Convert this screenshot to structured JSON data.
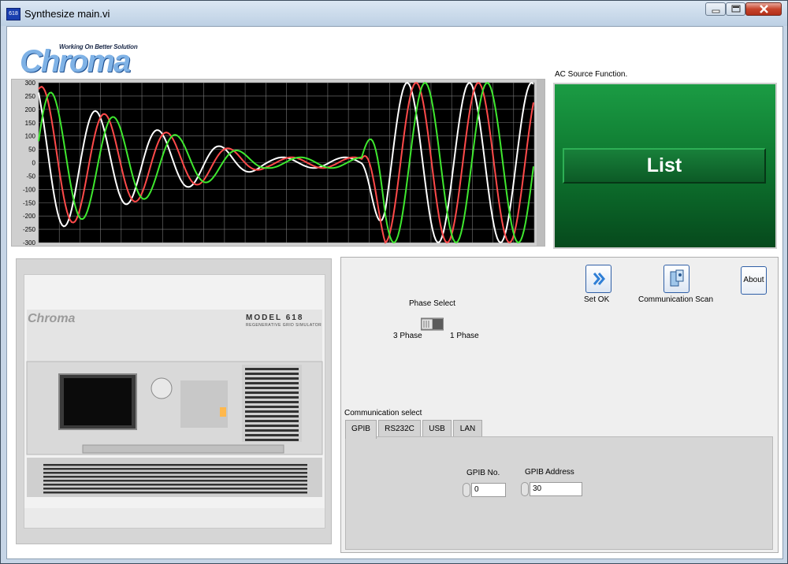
{
  "window": {
    "title": "Synthesize main.vi",
    "app_icon": "618"
  },
  "logo": {
    "tagline": "Working On Better Solution",
    "brand": "Chroma"
  },
  "graph": {
    "y_ticks": [
      "300",
      "250",
      "200",
      "150",
      "100",
      "50",
      "0",
      "-50",
      "-100",
      "-150",
      "-200",
      "-250",
      "-300"
    ],
    "series_colors": [
      "#ffffff",
      "#ff4a4a",
      "#3fe82f"
    ]
  },
  "ac_source": {
    "label": "AC Source Function.",
    "function_button": "List"
  },
  "device_image": {
    "brand": "Chroma",
    "model": "MODEL 618",
    "subtitle": "REGENERATIVE GRID SIMULATOR"
  },
  "controls": {
    "set_ok": "Set OK",
    "comm_scan": "Communication Scan",
    "about": "About",
    "phase_select": {
      "label": "Phase Select",
      "left": "3 Phase",
      "right": "1 Phase",
      "value": "1 Phase"
    },
    "comm_select": {
      "label": "Communication select",
      "tabs": [
        "GPIB",
        "RS232C",
        "USB",
        "LAN"
      ],
      "active": "GPIB",
      "gpib_no": {
        "label": "GPIB No.",
        "value": "0"
      },
      "gpib_address": {
        "label": "GPIB Address",
        "value": "30"
      }
    }
  }
}
